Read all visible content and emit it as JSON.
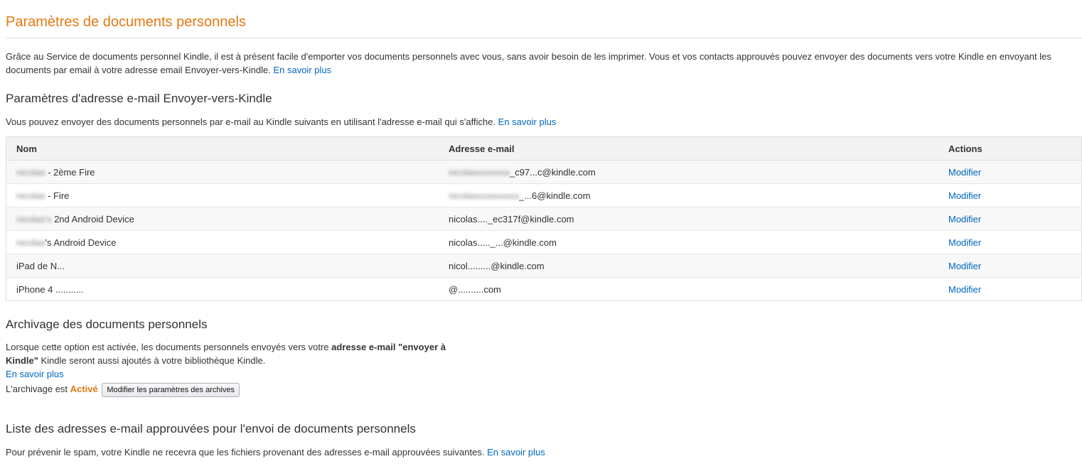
{
  "page": {
    "title": "Paramètres de documents personnels",
    "intro_text": "Grâce au Service de documents personnel Kindle, il est à présent facile d'emporter vos documents personnels avec vous, sans avoir besoin de les imprimer. Vous et vos contacts approuvés pouvez envoyer des documents vers votre Kindle en envoyant les documents par email à votre adresse email Envoyer-vers-Kindle. ",
    "intro_link": "En savoir plus"
  },
  "email_section": {
    "heading": "Paramètres d'adresse e-mail Envoyer-vers-Kindle",
    "description": "Vous pouvez envoyer des documents personnels par e-mail au Kindle suivants en utilisant l'adresse e-mail qui s'affiche. ",
    "link": "En savoir plus",
    "columns": {
      "name": "Nom",
      "email": "Adresse e-mail",
      "actions": "Actions"
    },
    "rows": [
      {
        "name_hidden": "nicolas",
        "name": " - 2ème Fire",
        "email_hidden": "nicolasxxxxxxx",
        "email": "_c97...c@kindle.com",
        "action": "Modifier"
      },
      {
        "name_hidden": "nicolas",
        "name": " - Fire",
        "email_hidden": "nicolasxxxxxxxxx",
        "email": "_...6@kindle.com",
        "action": "Modifier"
      },
      {
        "name_hidden": "nicolas's",
        "name": " 2nd Android Device",
        "email_hidden": "",
        "email": "nicolas...._ec317f@kindle.com",
        "action": "Modifier"
      },
      {
        "name_hidden": "nicolas",
        "name": "'s Android Device",
        "email_hidden": "",
        "email": "nicolas....._...@kindle.com",
        "action": "Modifier"
      },
      {
        "name_hidden": "",
        "name": "iPad de N...",
        "email_hidden": "",
        "email": "nicol.........@kindle.com",
        "action": "Modifier"
      },
      {
        "name_hidden": "",
        "name": "iPhone 4 ...........",
        "email_hidden": "",
        "email": "@..........com",
        "action": "Modifier"
      }
    ]
  },
  "archive_section": {
    "heading": "Archivage des documents personnels",
    "text_before": "Lorsque cette option est activée, les documents personnels envoyés vers votre ",
    "text_bold": "adresse e-mail \"envoyer à Kindle\"",
    "text_after": " Kindle seront aussi ajoutés à votre bibliothèque Kindle.",
    "link": "En savoir plus",
    "status_label": "L'archivage est ",
    "status_value": "Activé",
    "button_label": "Modifier les paramètres des archives"
  },
  "approved_section": {
    "heading": "Liste des adresses e-mail approuvées pour l'envoi de documents personnels",
    "description": "Pour prévenir le spam, votre Kindle ne recevra que les fichiers provenant des adresses e-mail approuvées suivantes. ",
    "link": "En savoir plus"
  },
  "colors": {
    "title": "#e47911",
    "link": "#0066c0",
    "active": "#e47911"
  }
}
